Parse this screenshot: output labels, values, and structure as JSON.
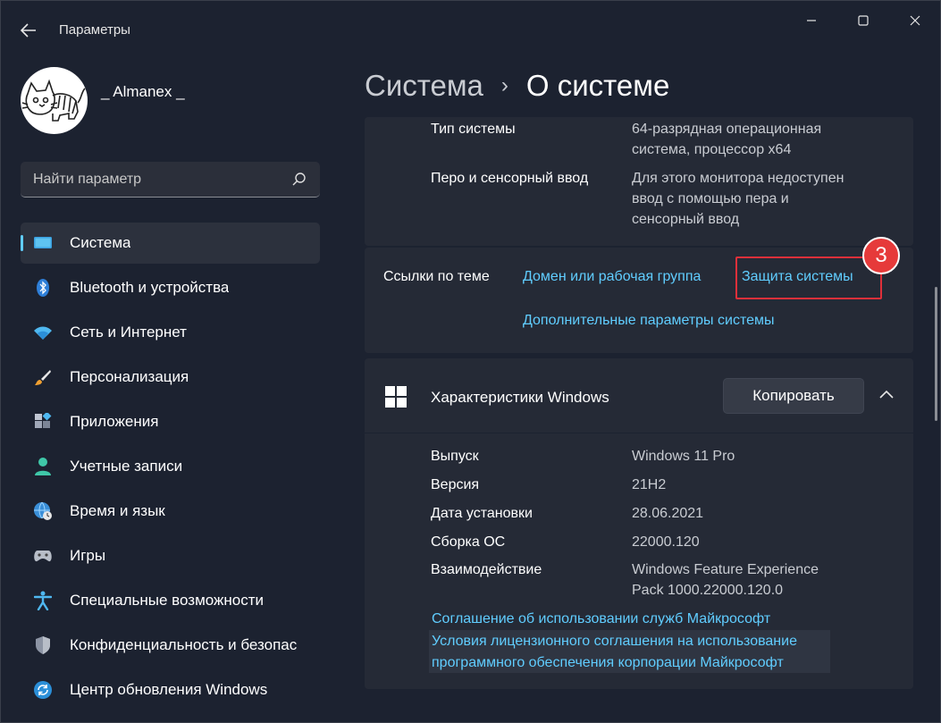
{
  "window": {
    "title": "Параметры",
    "back_icon": "back-arrow-icon",
    "controls": [
      "minimize-icon",
      "maximize-icon",
      "close-icon"
    ]
  },
  "user": {
    "name": "_ Almanex _"
  },
  "search": {
    "placeholder": "Найти параметр",
    "value": ""
  },
  "sidebar": {
    "items": [
      {
        "label": "Система",
        "icon": "system-icon",
        "active": true
      },
      {
        "label": "Bluetooth и устройства",
        "icon": "bluetooth-icon"
      },
      {
        "label": "Сеть и Интернет",
        "icon": "wifi-icon"
      },
      {
        "label": "Персонализация",
        "icon": "brush-icon"
      },
      {
        "label": "Приложения",
        "icon": "apps-icon"
      },
      {
        "label": "Учетные записи",
        "icon": "account-icon"
      },
      {
        "label": "Время и язык",
        "icon": "globe-clock-icon"
      },
      {
        "label": "Игры",
        "icon": "gamepad-icon"
      },
      {
        "label": "Специальные возможности",
        "icon": "accessibility-icon"
      },
      {
        "label": "Конфиденциальность и безопас",
        "icon": "shield-icon"
      },
      {
        "label": "Центр обновления Windows",
        "icon": "update-icon"
      }
    ]
  },
  "breadcrumb": {
    "parent": "Система",
    "separator": "›",
    "current": "О системе"
  },
  "device_specs": [
    {
      "label": "Тип системы",
      "value_lines": [
        "64-разрядная операционная",
        "система, процессор x64"
      ]
    },
    {
      "label": "Перо и сенсорный ввод",
      "value_lines": [
        "Для этого монитора недоступен",
        "ввод с помощью пера и",
        "сенсорный ввод"
      ]
    }
  ],
  "related_links": {
    "label": "Ссылки по теме",
    "domain": "Домен или рабочая группа",
    "protection": "Защита системы",
    "advanced": "Дополнительные параметры системы",
    "step_badge": "3"
  },
  "windows_specs": {
    "title": "Характеристики Windows",
    "copy_label": "Копировать",
    "rows": [
      {
        "label": "Выпуск",
        "value_lines": [
          "Windows 11 Pro"
        ]
      },
      {
        "label": "Версия",
        "value_lines": [
          "21H2"
        ]
      },
      {
        "label": "Дата установки",
        "value_lines": [
          "28.06.2021"
        ]
      },
      {
        "label": "Сборка ОС",
        "value_lines": [
          "22000.120"
        ]
      },
      {
        "label": "Взаимодействие",
        "value_lines": [
          "Windows Feature Experience",
          "Pack 1000.22000.120.0"
        ]
      }
    ],
    "links": [
      "Соглашение об использовании служб Майкрософт",
      "Условия лицензионного соглашения на использование",
      "программного обеспечения корпорации Майкрософт"
    ]
  },
  "colors": {
    "accent": "#60cdff",
    "highlight": "#e0303a"
  }
}
